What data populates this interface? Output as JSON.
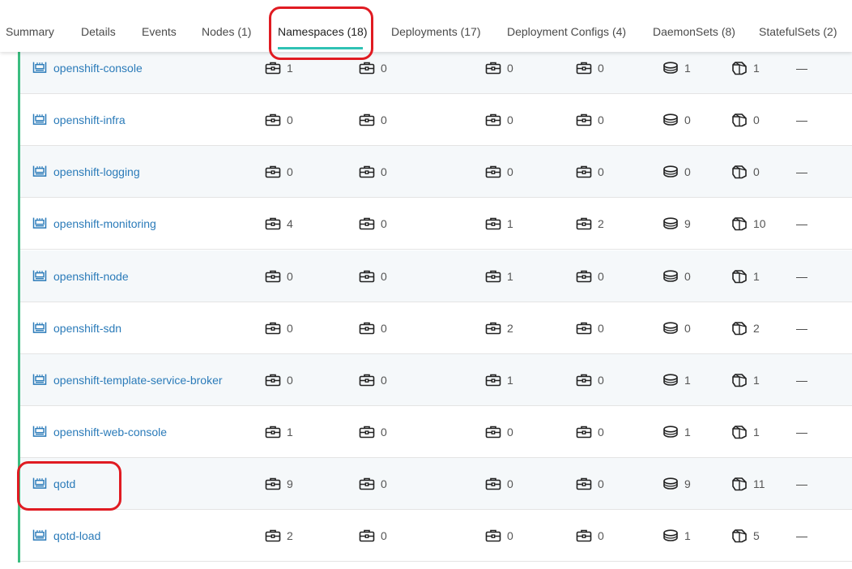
{
  "tabs": [
    {
      "label": "Summary",
      "active": false
    },
    {
      "label": "Details",
      "active": false
    },
    {
      "label": "Events",
      "active": false
    },
    {
      "label": "Nodes (1)",
      "active": false
    },
    {
      "label": "Namespaces (18)",
      "active": true
    },
    {
      "label": "Deployments (17)",
      "active": false
    },
    {
      "label": "Deployment Configs (4)",
      "active": false
    },
    {
      "label": "DaemonSets (8)",
      "active": false
    },
    {
      "label": "StatefulSets (2)",
      "active": false
    }
  ],
  "colors": {
    "accent_underline": "#2fc2b4",
    "link": "#2b7bb9",
    "status_bar": "#3bbd80",
    "annotation_highlight": "#e01b22"
  },
  "columns_icons": [
    "deployments-icon",
    "deployment-configs-icon",
    "daemonsets-icon",
    "statefulsets-icon",
    "replicasets-icon",
    "pods-icon"
  ],
  "namespaces": [
    {
      "name": "openshift-console",
      "metrics": [
        "1",
        "0",
        "0",
        "0",
        "1",
        "1"
      ],
      "extra": "—"
    },
    {
      "name": "openshift-infra",
      "metrics": [
        "0",
        "0",
        "0",
        "0",
        "0",
        "0"
      ],
      "extra": "—"
    },
    {
      "name": "openshift-logging",
      "metrics": [
        "0",
        "0",
        "0",
        "0",
        "0",
        "0"
      ],
      "extra": "—"
    },
    {
      "name": "openshift-monitoring",
      "metrics": [
        "4",
        "0",
        "1",
        "2",
        "9",
        "10"
      ],
      "extra": "—"
    },
    {
      "name": "openshift-node",
      "metrics": [
        "0",
        "0",
        "1",
        "0",
        "0",
        "1"
      ],
      "extra": "—"
    },
    {
      "name": "openshift-sdn",
      "metrics": [
        "0",
        "0",
        "2",
        "0",
        "0",
        "2"
      ],
      "extra": "—"
    },
    {
      "name": "openshift-template-service-broker",
      "metrics": [
        "0",
        "0",
        "1",
        "0",
        "1",
        "1"
      ],
      "extra": "—"
    },
    {
      "name": "openshift-web-console",
      "metrics": [
        "1",
        "0",
        "0",
        "0",
        "1",
        "1"
      ],
      "extra": "—"
    },
    {
      "name": "qotd",
      "metrics": [
        "9",
        "0",
        "0",
        "0",
        "9",
        "11"
      ],
      "extra": "—"
    },
    {
      "name": "qotd-load",
      "metrics": [
        "2",
        "0",
        "0",
        "0",
        "1",
        "5"
      ],
      "extra": "—"
    }
  ]
}
